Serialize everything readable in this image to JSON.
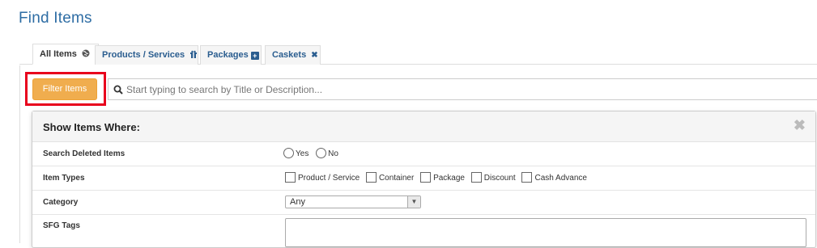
{
  "page": {
    "title": "Find Items"
  },
  "tabs": [
    {
      "label": "All Items",
      "icon": "globe-icon"
    },
    {
      "label": "Products / Services",
      "icon": "gift-icon"
    },
    {
      "label": "Packages",
      "icon": "plus-square-icon"
    },
    {
      "label": "Caskets",
      "icon": "close-icon"
    }
  ],
  "toolbar": {
    "filter_label": "Filter Items",
    "search_placeholder": "Start typing to search by Title or Description..."
  },
  "filter_panel": {
    "title": "Show Items Where:",
    "close_glyph": "✖",
    "rows": {
      "deleted": {
        "label": "Search Deleted Items",
        "options": [
          "Yes",
          "No"
        ]
      },
      "types": {
        "label": "Item Types",
        "options": [
          "Product / Service",
          "Container",
          "Package",
          "Discount",
          "Cash Advance"
        ]
      },
      "category": {
        "label": "Category",
        "value": "Any"
      },
      "tags": {
        "label": "SFG Tags",
        "value": ""
      }
    }
  },
  "colors": {
    "accent": "#2e6da4",
    "filter_button": "#f0ad4e",
    "highlight": "#e8001c"
  }
}
